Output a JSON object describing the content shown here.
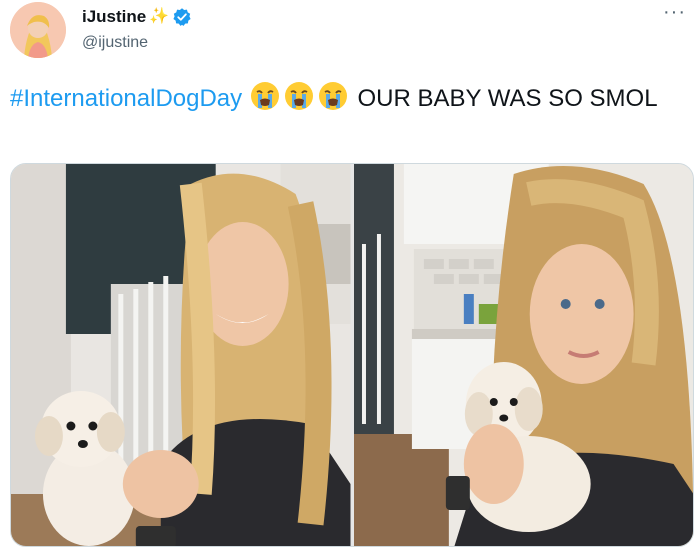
{
  "tweet": {
    "display_name": "iJustine",
    "name_emoji": "✨",
    "handle": "@ijustine",
    "more_label": "···",
    "hashtag": "#InternationalDogDay",
    "text_after": " OUR BABY WAS SO SMOL",
    "emoji_count": 3
  },
  "colors": {
    "hashtag": "#1d9bf0",
    "verified": "#1d9bf0",
    "secondary_text": "#536471"
  },
  "icons": {
    "verified": "verified-badge-icon",
    "more": "more-horizontal-icon",
    "sparkle": "sparkles-icon",
    "emoji": "loudly-crying-face-emoji"
  }
}
